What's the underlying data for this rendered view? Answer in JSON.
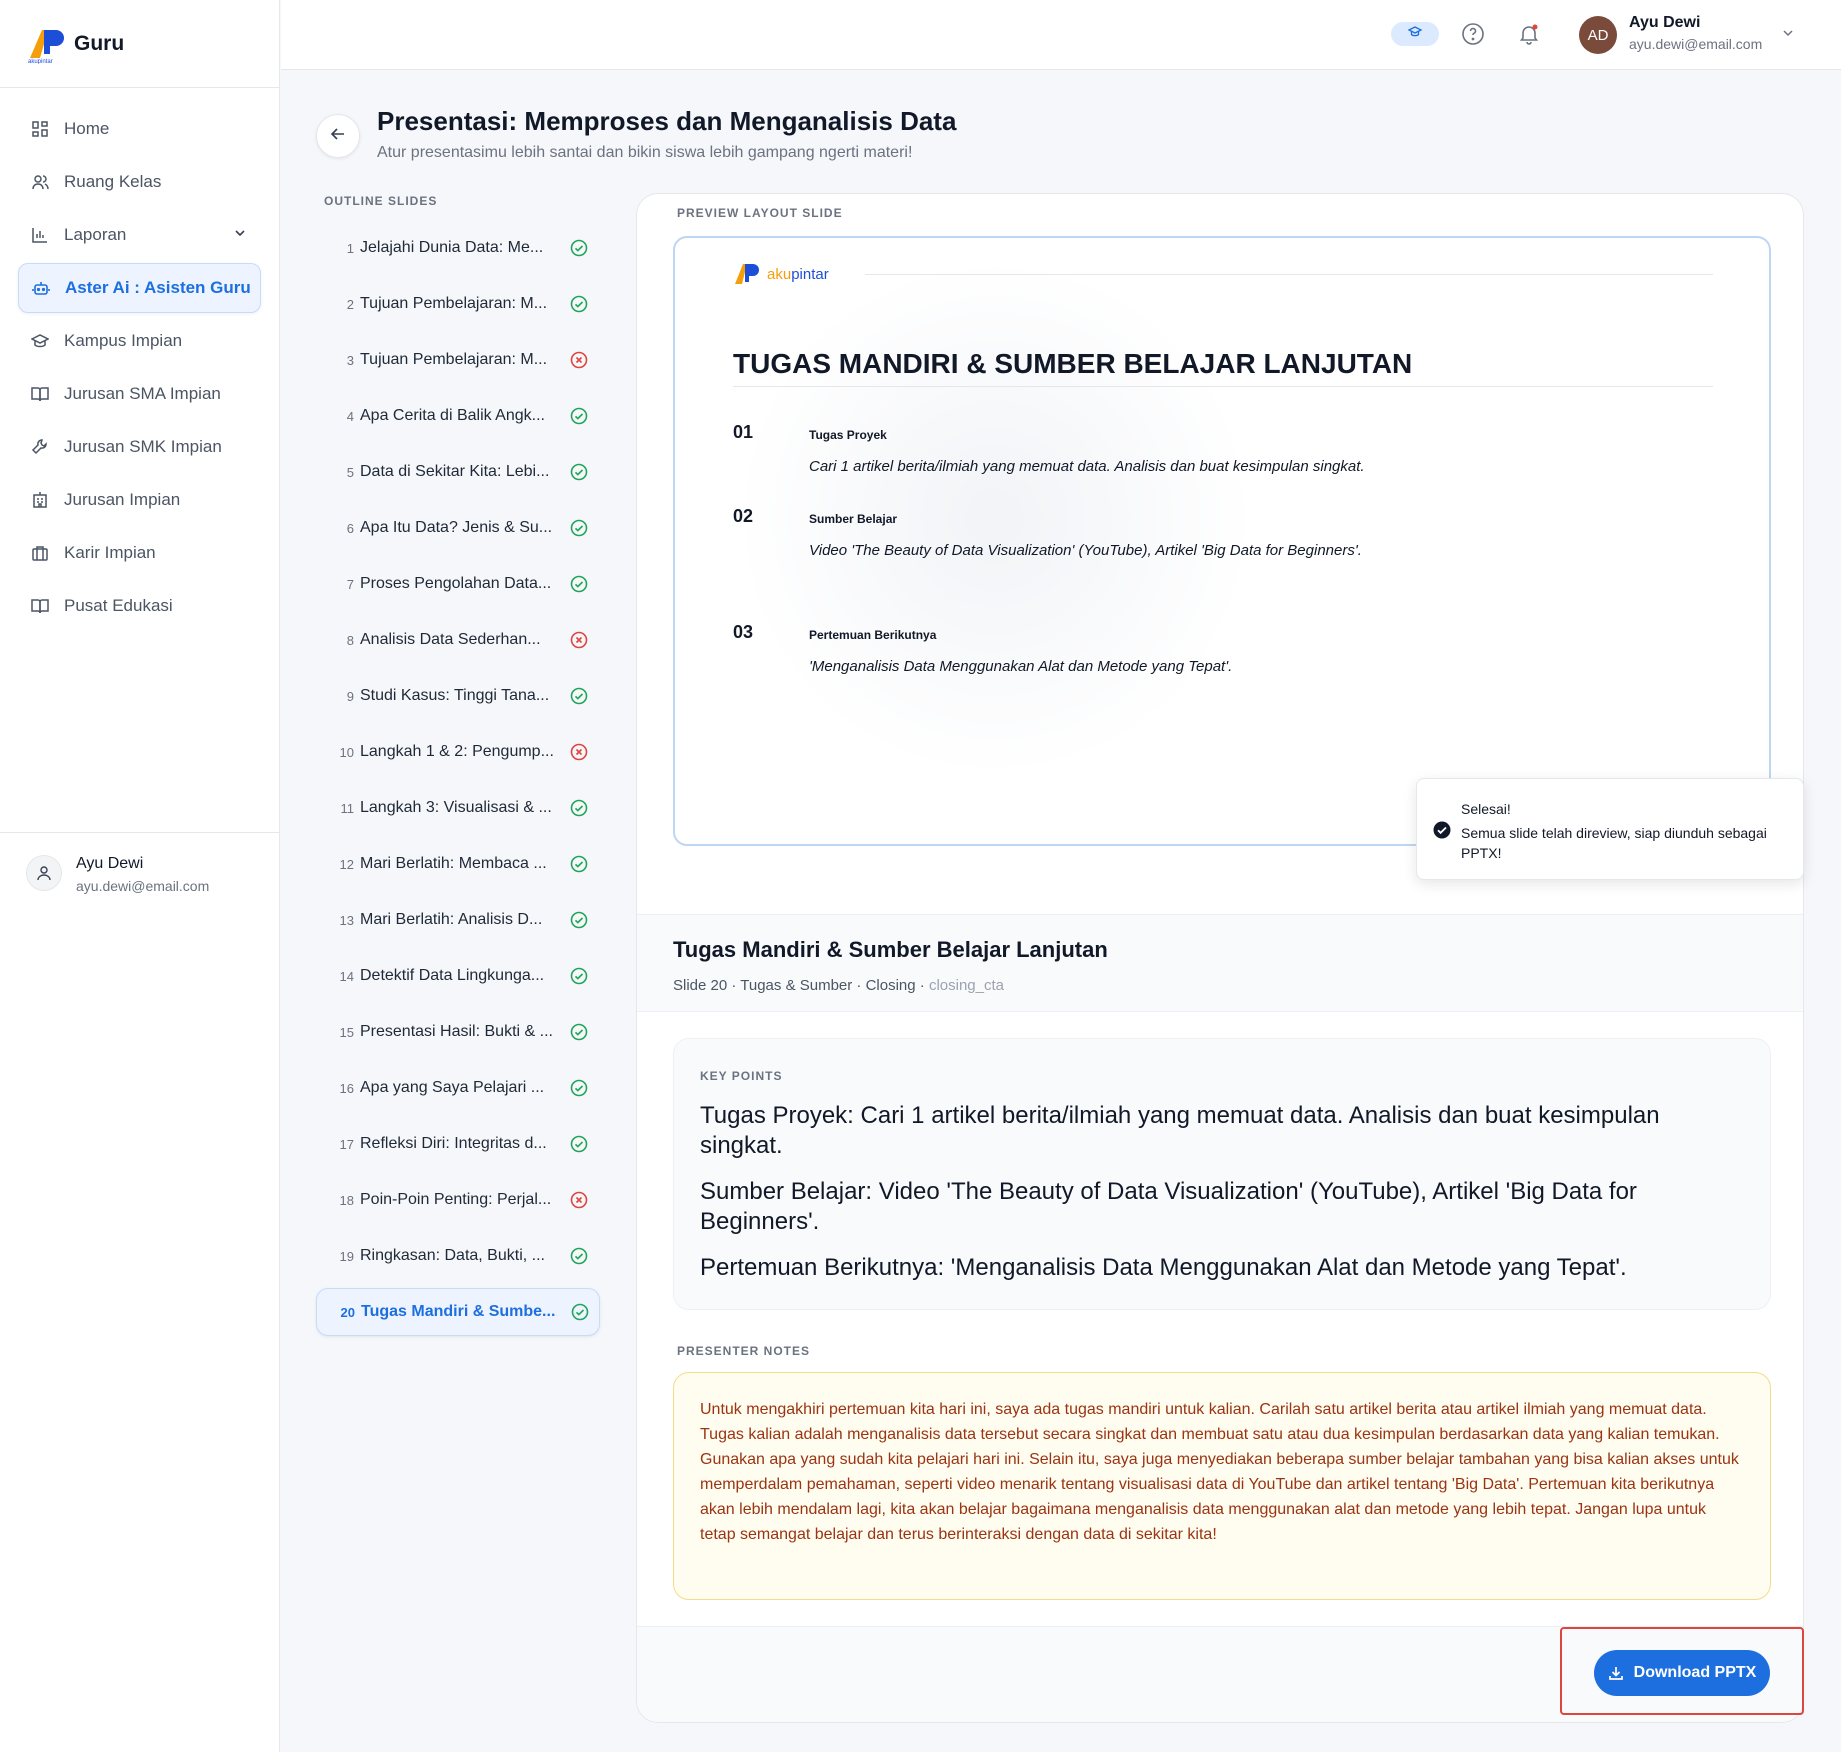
{
  "brand": {
    "name": "Guru",
    "logo_text": "akupintar"
  },
  "sidebar": {
    "items": [
      {
        "label": "Home",
        "icon": "grid-icon"
      },
      {
        "label": "Ruang Kelas",
        "icon": "users-icon"
      },
      {
        "label": "Laporan",
        "icon": "bar-chart-icon",
        "expandable": true
      },
      {
        "label": "Aster Ai : Asisten Guru",
        "icon": "robot-icon",
        "active": true
      },
      {
        "label": "Kampus Impian",
        "icon": "graduation-cap-icon"
      },
      {
        "label": "Jurusan SMA Impian",
        "icon": "book-open-icon"
      },
      {
        "label": "Jurusan SMK Impian",
        "icon": "wrench-icon"
      },
      {
        "label": "Jurusan Impian",
        "icon": "building-icon"
      },
      {
        "label": "Karir Impian",
        "icon": "briefcase-icon"
      },
      {
        "label": "Pusat Edukasi",
        "icon": "book-icon"
      }
    ],
    "user": {
      "name": "Ayu Dewi",
      "email": "ayu.dewi@email.com"
    }
  },
  "topbar": {
    "avatar_initials": "AD",
    "user_name": "Ayu Dewi",
    "user_email": "ayu.dewi@email.com"
  },
  "page": {
    "title": "Presentasi: Memproses dan Menganalisis Data",
    "subtitle": "Atur presentasimu lebih santai dan bikin siswa lebih gampang ngerti materi!"
  },
  "outline": {
    "label": "OUTLINE SLIDES",
    "items": [
      {
        "num": "1",
        "title": "Jelajahi Dunia Data: Me...",
        "status": "ok"
      },
      {
        "num": "2",
        "title": "Tujuan Pembelajaran: M...",
        "status": "ok"
      },
      {
        "num": "3",
        "title": "Tujuan Pembelajaran: M...",
        "status": "error"
      },
      {
        "num": "4",
        "title": "Apa Cerita di Balik Angk...",
        "status": "ok"
      },
      {
        "num": "5",
        "title": "Data di Sekitar Kita: Lebi...",
        "status": "ok"
      },
      {
        "num": "6",
        "title": "Apa Itu Data? Jenis & Su...",
        "status": "ok"
      },
      {
        "num": "7",
        "title": "Proses Pengolahan Data...",
        "status": "ok"
      },
      {
        "num": "8",
        "title": "Analisis Data Sederhan...",
        "status": "error"
      },
      {
        "num": "9",
        "title": "Studi Kasus: Tinggi Tana...",
        "status": "ok"
      },
      {
        "num": "10",
        "title": "Langkah 1 & 2: Pengump...",
        "status": "error"
      },
      {
        "num": "11",
        "title": "Langkah 3: Visualisasi & ...",
        "status": "ok"
      },
      {
        "num": "12",
        "title": "Mari Berlatih: Membaca ...",
        "status": "ok"
      },
      {
        "num": "13",
        "title": "Mari Berlatih: Analisis D...",
        "status": "ok"
      },
      {
        "num": "14",
        "title": "Detektif Data Lingkunga...",
        "status": "ok"
      },
      {
        "num": "15",
        "title": "Presentasi Hasil: Bukti & ...",
        "status": "ok"
      },
      {
        "num": "16",
        "title": "Apa yang Saya Pelajari ...",
        "status": "ok"
      },
      {
        "num": "17",
        "title": "Refleksi Diri: Integritas d...",
        "status": "ok"
      },
      {
        "num": "18",
        "title": "Poin-Poin Penting: Perjal...",
        "status": "error"
      },
      {
        "num": "19",
        "title": "Ringkasan: Data, Bukti, ...",
        "status": "ok"
      },
      {
        "num": "20",
        "title": "Tugas Mandiri & Sumbe...",
        "status": "ok",
        "active": true
      }
    ]
  },
  "preview": {
    "label": "PREVIEW LAYOUT SLIDE",
    "slide_title": "TUGAS MANDIRI & SUMBER BELAJAR LANJUTAN",
    "points": [
      {
        "num": "01",
        "head": "Tugas Proyek",
        "body": "Cari 1 artikel berita/ilmiah yang memuat data. Analisis dan buat kesimpulan singkat."
      },
      {
        "num": "02",
        "head": "Sumber Belajar",
        "body": "Video 'The Beauty of Data Visualization' (YouTube), Artikel 'Big Data for Beginners'."
      },
      {
        "num": "03",
        "head": "Pertemuan Berikutnya",
        "body": "'Menganalisis Data Menggunakan Alat dan Metode yang Tepat'."
      }
    ]
  },
  "toast": {
    "title": "Selesai!",
    "body": "Semua slide telah direview, siap diunduh sebagai PPTX!"
  },
  "slide_info": {
    "title": "Tugas Mandiri & Sumber Belajar Lanjutan",
    "meta_main": "Slide 20 · Tugas & Sumber · Closing · ",
    "meta_type": "closing_cta"
  },
  "key_points": {
    "label": "KEY POINTS",
    "items": [
      "Tugas Proyek: Cari 1 artikel berita/ilmiah yang memuat data. Analisis dan buat kesimpulan singkat.",
      "Sumber Belajar: Video 'The Beauty of Data Visualization' (YouTube), Artikel 'Big Data for Beginners'.",
      "Pertemuan Berikutnya: 'Menganalisis Data Menggunakan Alat dan Metode yang Tepat'."
    ]
  },
  "presenter_notes": {
    "label": "PRESENTER NOTES",
    "text": "Untuk mengakhiri pertemuan kita hari ini, saya ada tugas mandiri untuk kalian. Carilah satu artikel berita atau artikel ilmiah yang memuat data. Tugas kalian adalah menganalisis data tersebut secara singkat dan membuat satu atau dua kesimpulan berdasarkan data yang kalian temukan. Gunakan apa yang sudah kita pelajari hari ini. Selain itu, saya juga menyediakan beberapa sumber belajar tambahan yang bisa kalian akses untuk memperdalam pemahaman, seperti video menarik tentang visualisasi data di YouTube dan artikel tentang 'Big Data'. Pertemuan kita berikutnya akan lebih mendalam lagi, kita akan belajar bagaimana menganalisis data menggunakan alat dan metode yang lebih tepat. Jangan lupa untuk tetap semangat belajar dan terus berinteraksi dengan data di sekitar kita!"
  },
  "download": {
    "label": "Download PPTX",
    "icon": "download-icon"
  },
  "colors": {
    "accent": "#1d6fe0",
    "ok": "#22a559",
    "error": "#e0443f",
    "notes_text": "#9a3412"
  }
}
